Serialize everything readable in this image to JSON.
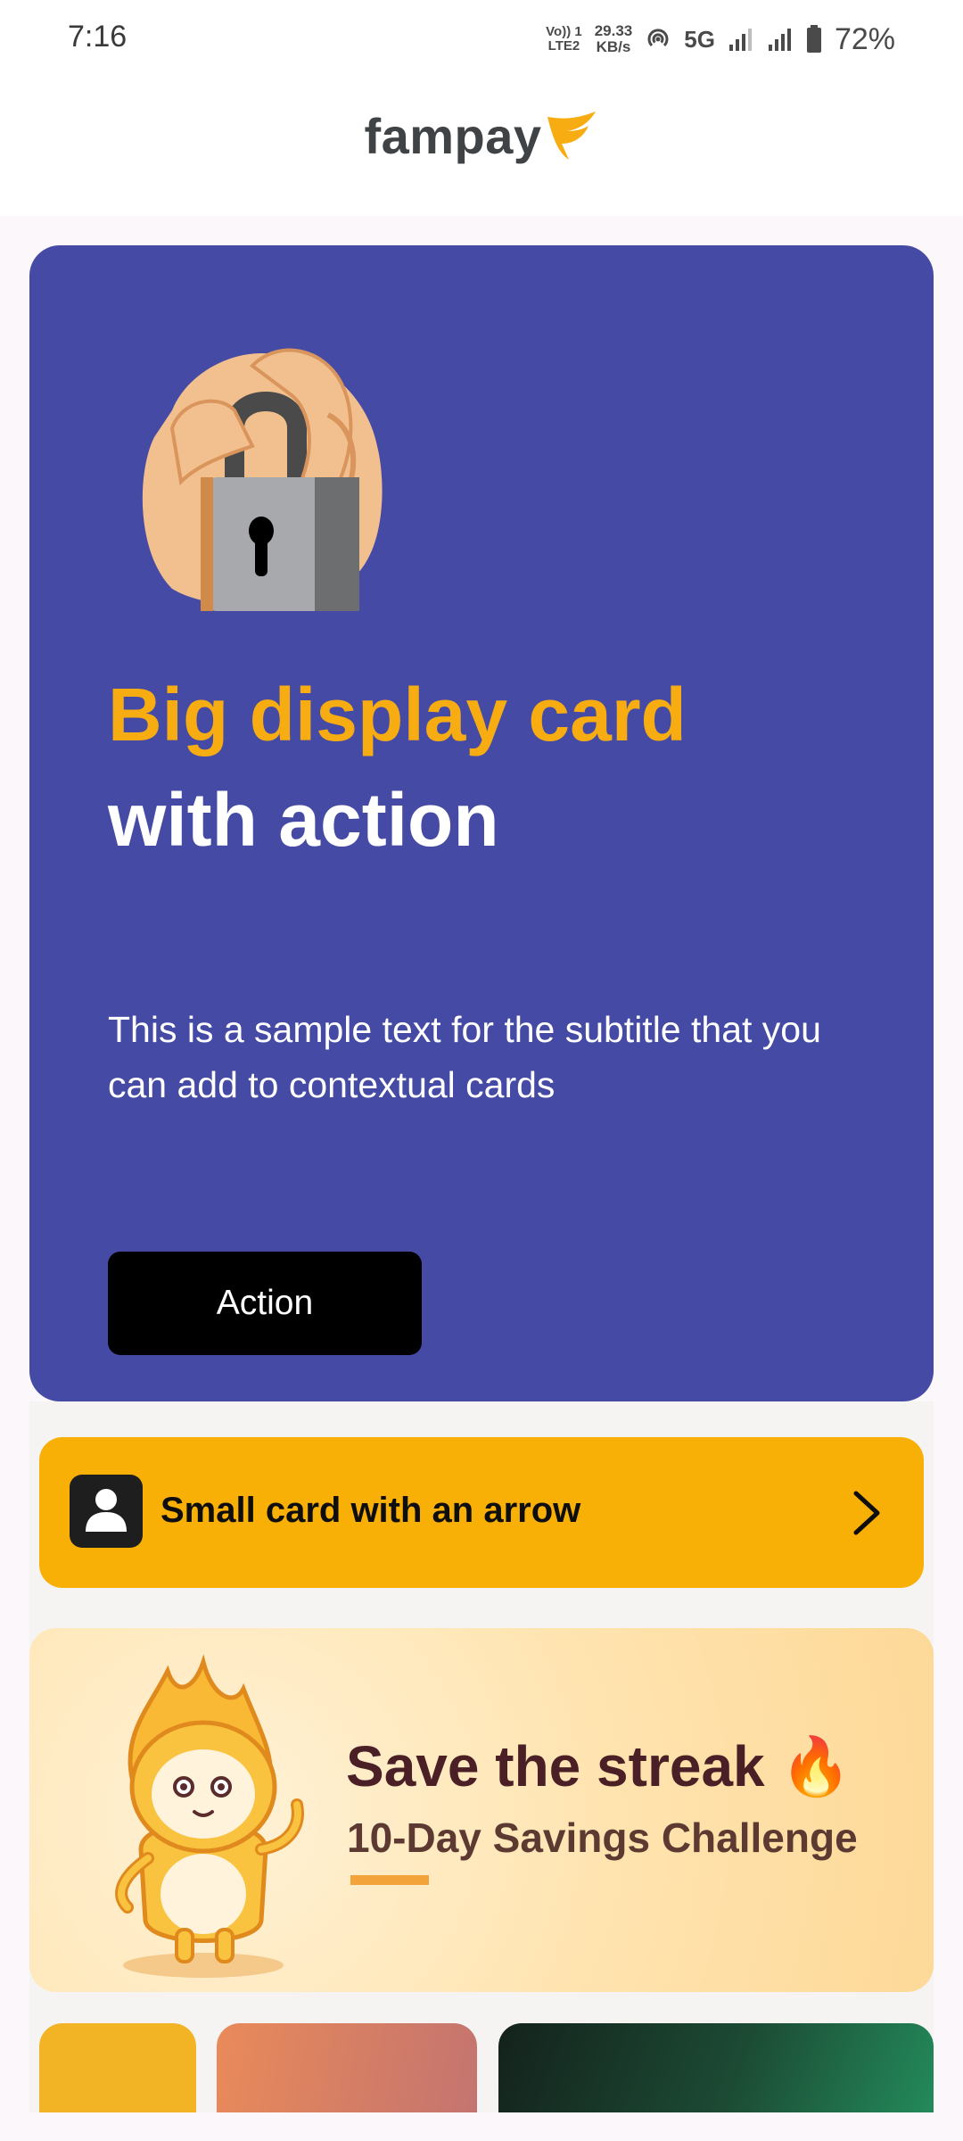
{
  "status_bar": {
    "time": "7:16",
    "volte_line1": "Vo)) 1",
    "volte_line2": "LTE2",
    "speed_value": "29.33",
    "speed_unit": "KB/s",
    "network": "5G",
    "battery": "72%",
    "icons": [
      "hotspot-icon",
      "signal-5g-icon",
      "signal-icon",
      "battery-icon"
    ]
  },
  "header": {
    "brand": "fampay",
    "logo_icon": "fampay-wing-logo",
    "brand_color": "#F7AC12"
  },
  "big_card": {
    "background": "#454BA5",
    "illustration": "hand-with-padlock",
    "title_highlight": "Big display card",
    "title_rest": "with action",
    "subtitle": "This is a sample text for the subtitle that you can add to contextual cards",
    "action_label": "Action"
  },
  "small_card": {
    "label": "Small card with an arrow",
    "icon": "user-icon",
    "arrow_icon": "chevron-right-icon",
    "background": "#F8AF06"
  },
  "streak_banner": {
    "title": "Save the streak 🔥",
    "subtitle": "10-Day Savings Challenge",
    "mascot": "flame-mascot"
  },
  "bottom_tiles": [
    {
      "color": "#F2B325"
    },
    {
      "color": "#E98A59"
    },
    {
      "color": "#1C4B34"
    }
  ]
}
